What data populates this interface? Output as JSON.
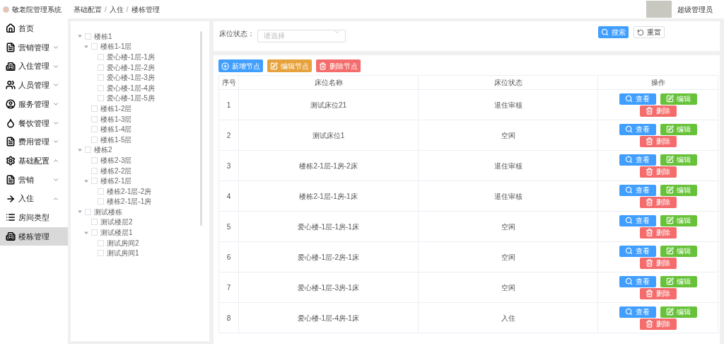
{
  "app_title": "敬老院管理系统",
  "breadcrumb": [
    {
      "label": "基础配置"
    },
    {
      "separator": "/",
      "label": "入住"
    },
    {
      "separator": "/",
      "label": "楼栋管理"
    }
  ],
  "user": {
    "name": "超级管理员"
  },
  "sidebar": [
    {
      "label": "首页",
      "selected": false
    },
    {
      "label": "营销管理",
      "expanded": false,
      "selected": false
    },
    {
      "label": "入住管理",
      "expanded": false,
      "selected": false
    },
    {
      "label": "人员管理",
      "expanded": false,
      "selected": false
    },
    {
      "label": "服务管理",
      "expanded": false,
      "selected": false
    },
    {
      "label": "餐饮管理",
      "expanded": false,
      "selected": false
    },
    {
      "label": "费用管理",
      "expanded": false,
      "selected": false
    },
    {
      "label": "基础配置",
      "expanded": true,
      "selected": false,
      "children": [
        {
          "label": "营销",
          "expanded": false,
          "selected": false
        },
        {
          "label": "入住",
          "expanded": true,
          "selected": false,
          "children": [
            {
              "label": "房间类型",
              "selected": false
            },
            {
              "label": "楼栋管理",
              "selected": true
            }
          ]
        }
      ]
    }
  ],
  "tree": [
    {
      "label": "楼栋1",
      "checked": false,
      "expanded": true,
      "children": [
        {
          "label": "楼栋1-1层",
          "checked": false,
          "expanded": true,
          "children": [
            {
              "label": "爱心楼-1层-1房",
              "checked": false
            },
            {
              "label": "爱心楼-1层-2房",
              "checked": false
            },
            {
              "label": "爱心楼-1层-3房",
              "checked": false
            },
            {
              "label": "爱心楼-1层-4房",
              "checked": false
            },
            {
              "label": "爱心楼-1层-5房",
              "checked": false
            }
          ]
        },
        {
          "label": "楼栋1-2层",
          "checked": false
        },
        {
          "label": "楼栋1-3层",
          "checked": false
        },
        {
          "label": "楼栋1-4层",
          "checked": false
        },
        {
          "label": "楼栋1-5层",
          "checked": false
        }
      ]
    },
    {
      "label": "楼栋2",
      "checked": false,
      "expanded": true,
      "children": [
        {
          "label": "楼栋2-3层",
          "checked": false
        },
        {
          "label": "楼栋2-2层",
          "checked": false
        },
        {
          "label": "楼栋2-1层",
          "checked": false,
          "expanded": true,
          "children": [
            {
              "label": "楼栋2-1层-2房",
              "checked": false
            },
            {
              "label": "楼栋2-1层-1房",
              "checked": false
            }
          ]
        }
      ]
    },
    {
      "label": "测试楼栋",
      "checked": false,
      "expanded": true,
      "children": [
        {
          "label": "测试楼层2",
          "checked": false
        },
        {
          "label": "测试楼层1",
          "checked": false,
          "expanded": true,
          "children": [
            {
              "label": "测试房间2",
              "checked": false
            },
            {
              "label": "测试房间1",
              "checked": false
            }
          ]
        }
      ]
    }
  ],
  "filter": {
    "label": "床位状态：",
    "placeholder": "请选择"
  },
  "filter_buttons": [
    {
      "kind": "primary",
      "label": "搜索"
    },
    {
      "kind": "default",
      "label": "重置"
    }
  ],
  "toolbar": [
    {
      "kind": "add",
      "label": "新增节点"
    },
    {
      "kind": "edit",
      "label": "编辑节点"
    },
    {
      "kind": "delete",
      "label": "删除节点"
    }
  ],
  "table": {
    "columns": [
      "序号",
      "床位名称",
      "床位状态",
      "操作"
    ],
    "rows": [
      {
        "index": "1",
        "name": "测试床位21",
        "status": "退住审核",
        "actions": [
          {
            "kind": "view",
            "label": "查看"
          },
          {
            "kind": "edit",
            "label": "编辑"
          },
          {
            "kind": "delete",
            "label": "删除"
          }
        ]
      },
      {
        "index": "2",
        "name": "测试床位1",
        "status": "空闲",
        "actions": [
          {
            "kind": "view",
            "label": "查看"
          },
          {
            "kind": "edit",
            "label": "编辑"
          },
          {
            "kind": "delete",
            "label": "删除"
          }
        ]
      },
      {
        "index": "3",
        "name": "楼栋2-1层-1房-2床",
        "status": "退住审核",
        "actions": [
          {
            "kind": "view",
            "label": "查看"
          },
          {
            "kind": "edit",
            "label": "编辑"
          },
          {
            "kind": "delete",
            "label": "删除"
          }
        ]
      },
      {
        "index": "4",
        "name": "楼栋2-1层-1房-1床",
        "status": "退住审核",
        "actions": [
          {
            "kind": "view",
            "label": "查看"
          },
          {
            "kind": "edit",
            "label": "编辑"
          },
          {
            "kind": "delete",
            "label": "删除"
          }
        ]
      },
      {
        "index": "5",
        "name": "爱心楼-1层-1房-1床",
        "status": "空闲",
        "actions": [
          {
            "kind": "view",
            "label": "查看"
          },
          {
            "kind": "edit",
            "label": "编辑"
          },
          {
            "kind": "delete",
            "label": "删除"
          }
        ]
      },
      {
        "index": "6",
        "name": "爱心楼-1层-2房-1床",
        "status": "空闲",
        "actions": [
          {
            "kind": "view",
            "label": "查看"
          },
          {
            "kind": "edit",
            "label": "编辑"
          },
          {
            "kind": "delete",
            "label": "删除"
          }
        ]
      },
      {
        "index": "7",
        "name": "爱心楼-1层-3房-1床",
        "status": "空闲",
        "actions": [
          {
            "kind": "view",
            "label": "查看"
          },
          {
            "kind": "edit",
            "label": "编辑"
          },
          {
            "kind": "delete",
            "label": "删除"
          }
        ]
      },
      {
        "index": "8",
        "name": "爱心楼-1层-4房-1床",
        "status": "入住",
        "actions": [
          {
            "kind": "view",
            "label": "查看"
          },
          {
            "kind": "edit",
            "label": "编辑"
          },
          {
            "kind": "delete",
            "label": "删除"
          }
        ]
      }
    ]
  }
}
